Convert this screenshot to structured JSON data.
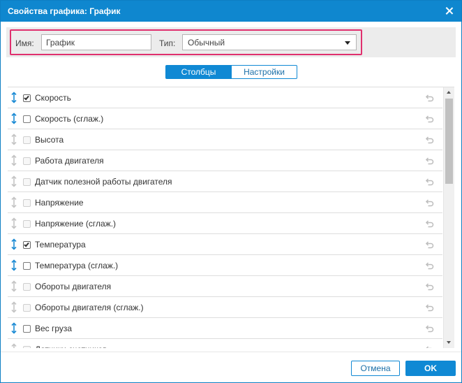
{
  "dialog": {
    "title": "Свойства графика: График",
    "close_icon": "close-icon"
  },
  "params": {
    "name_label": "Имя:",
    "name_value": "График",
    "type_label": "Тип:",
    "type_value": "Обычный"
  },
  "tabs": [
    {
      "label": "Столбцы",
      "active": true
    },
    {
      "label": "Настройки",
      "active": false
    }
  ],
  "columns": [
    {
      "label": "Скорость",
      "checked": true,
      "enabled": true
    },
    {
      "label": "Скорость (сглаж.)",
      "checked": false,
      "enabled": true
    },
    {
      "label": "Высота",
      "checked": false,
      "enabled": false
    },
    {
      "label": "Работа двигателя",
      "checked": false,
      "enabled": false
    },
    {
      "label": "Датчик полезной работы двигателя",
      "checked": false,
      "enabled": false
    },
    {
      "label": "Напряжение",
      "checked": false,
      "enabled": false
    },
    {
      "label": "Напряжение (сглаж.)",
      "checked": false,
      "enabled": false
    },
    {
      "label": "Температура",
      "checked": true,
      "enabled": true
    },
    {
      "label": "Температура (сглаж.)",
      "checked": false,
      "enabled": true
    },
    {
      "label": "Обороты двигателя",
      "checked": false,
      "enabled": false
    },
    {
      "label": "Обороты двигателя (сглаж.)",
      "checked": false,
      "enabled": false
    },
    {
      "label": "Вес груза",
      "checked": false,
      "enabled": true
    },
    {
      "label": "Датчики счетчиков",
      "checked": false,
      "enabled": false
    }
  ],
  "footer": {
    "cancel_label": "Отмена",
    "ok_label": "OK"
  },
  "colors": {
    "accent": "#1089d4",
    "titlebar": "#0f87cf",
    "highlight_border": "#e0306e",
    "drag_active": "#1a8ad4",
    "drag_inactive": "#c4c4c4",
    "reset_icon": "#bdbdbd"
  }
}
